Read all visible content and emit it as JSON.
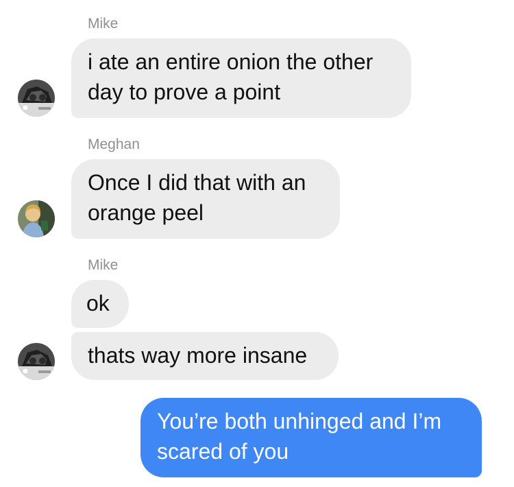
{
  "messages": [
    {
      "sender": "Mike",
      "text_lines": [
        "i ate an entire onion the other",
        "day to prove a point"
      ]
    },
    {
      "sender": "Meghan",
      "text_lines": [
        "Once I did that with an",
        "orange peel"
      ]
    },
    {
      "sender": "Mike",
      "text": "ok"
    },
    {
      "text": "thats way more insane"
    },
    {
      "outgoing": true,
      "text_lines": [
        "You’re both unhinged and I’m",
        "scared of you"
      ]
    }
  ],
  "colors": {
    "incoming_bubble": "#ececec",
    "outgoing_bubble": "#3f87f5",
    "sender_name": "#8e8e93"
  },
  "icons": [
    "mike-avatar",
    "meghan-avatar"
  ]
}
